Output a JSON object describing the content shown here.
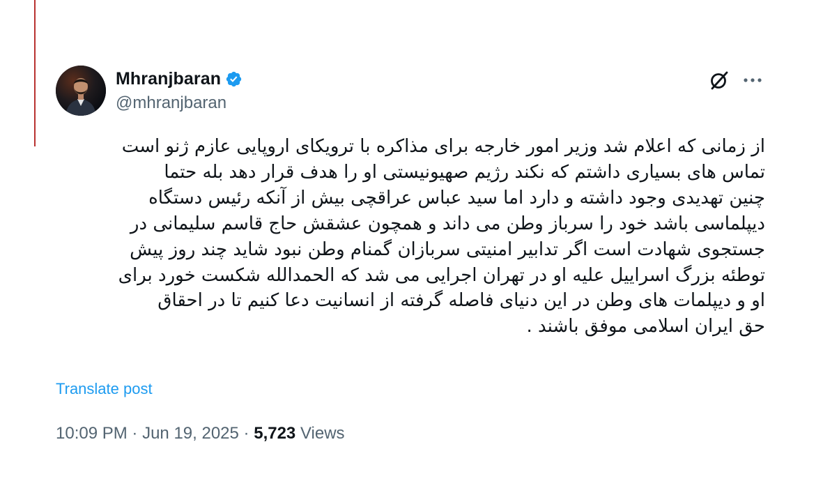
{
  "author": {
    "display_name": "Mhranjbaran",
    "handle": "@mhranjbaran",
    "verified": true,
    "verified_color": "#1d9bf0"
  },
  "icons": {
    "verified": "verified-badge-icon",
    "grok": "grok-icon",
    "more": "more-options-icon"
  },
  "tweet": {
    "lines": [
      "از زمانی که اعلام شد وزیر امور خارجه برای مذاکره با ترویکای اروپایی عازم ژنو است",
      "تماس های بسیاری داشتم که نکند رژیم صهیونیستی او را هدف قرار دهد بله حتما",
      "چنین تهدیدی وجود داشته و دارد اما سید عباس عراقچی بیش از آنکه رئیس دستگاه",
      "دیپلماسی باشد خود را سرباز وطن می داند و همچون عشقش حاج قاسم سلیمانی در",
      "جستجوی شهادت است اگر تدابیر امنیتی سربازان گمنام وطن نبود شاید چند روز پیش",
      "توطئه بزرگ اسراییل علیه او در تهران اجرایی می شد که الحمدالله شکست خورد برای",
      "او و دیپلمات های وطن در این دنیای  فاصله گرفته از انسانیت دعا کنیم تا در احقاق",
      "حق ایران اسلامی موفق باشند ."
    ],
    "translate_label": "Translate post"
  },
  "meta": {
    "time": "10:09 PM",
    "separator": "·",
    "date": "Jun 19, 2025",
    "views_count": "5,723",
    "views_label": "Views"
  },
  "colors": {
    "text_primary": "#0f1419",
    "text_secondary": "#536471",
    "link": "#1d9bf0",
    "left_rule": "#b8312f"
  }
}
